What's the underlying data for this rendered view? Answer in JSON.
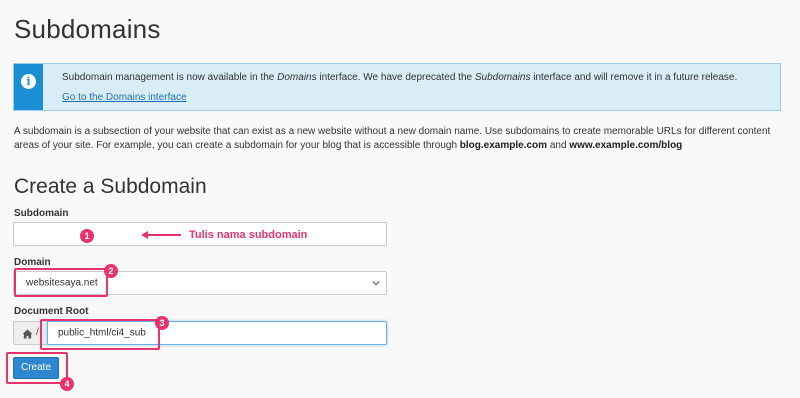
{
  "page": {
    "title": "Subdomains"
  },
  "notice": {
    "text_before_1": "Subdomain management is now available in the ",
    "text_em_1": "Domains",
    "text_between": " interface. We have deprecated the ",
    "text_em_2": "Subdomains",
    "text_after_2": " interface and will remove it in a future release.",
    "link_label": "Go to the Domains interface",
    "icon": "info-icon"
  },
  "description": {
    "text_1": "A subdomain is a subsection of your website that can exist as a new website without a new domain name. Use subdomains to create memorable URLs for different content areas of your site. For example, you can create a subdomain for your blog that is accessible through ",
    "bold_1": "blog.example.com",
    "text_2": " and ",
    "bold_2": "www.example.com/blog"
  },
  "form": {
    "section_title": "Create a Subdomain",
    "subdomain": {
      "label": "Subdomain",
      "value": ""
    },
    "domain": {
      "label": "Domain",
      "selected": "websitesaya.net"
    },
    "document_root": {
      "label": "Document Root",
      "prefix": "/",
      "value": "public_html/ci4_sub"
    },
    "create_label": "Create"
  },
  "annotations": {
    "hint_text": "Tulis nama subdomain",
    "badges": [
      "1",
      "2",
      "3",
      "4"
    ]
  },
  "colors": {
    "accent": "#e8336d",
    "primary_button": "#2e86d1",
    "info_bar": "#1a8fd4",
    "info_bg": "#d9edf7"
  }
}
